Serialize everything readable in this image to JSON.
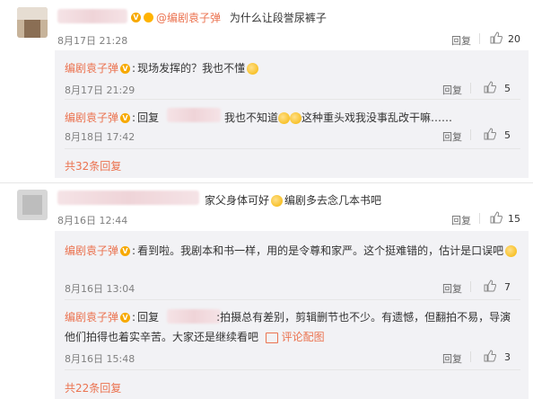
{
  "thread1": {
    "top": {
      "prefix": "",
      "mention": "@编剧袁子弹",
      "text": "为什么让段誉尿裤子",
      "time": "8月17日 21:28",
      "reply_label": "回复",
      "likes": "20"
    },
    "replies": [
      {
        "author": "编剧袁子弹",
        "text": "现场发挥的？我也不懂",
        "time": "8月17日 21:29",
        "reply_label": "回复",
        "likes": "5"
      },
      {
        "author": "编剧袁子弹",
        "reply_word": "回复",
        "text_a": "我也不知道",
        "text_b": "这种重头戏我没事乱改干嘛……",
        "time": "8月18日 17:42",
        "reply_label": "回复",
        "likes": "5"
      }
    ],
    "more": "共32条回复"
  },
  "thread2": {
    "top": {
      "text": "家父身体可好",
      "text_b": "编剧多去念几本书吧",
      "time": "8月16日 12:44",
      "reply_label": "回复",
      "likes": "15"
    },
    "replies": [
      {
        "author": "编剧袁子弹",
        "text": "看到啦。我剧本和书一样，用的是令尊和家严。这个挺难错的，估计是口误吧",
        "time": "8月16日 13:04",
        "reply_label": "回复",
        "likes": "7"
      },
      {
        "author": "编剧袁子弹",
        "reply_word": "回复",
        "text": ":拍摄总有差别，剪辑删节也不少。有遗憾，但翻拍不易，导演他们拍得也着实辛苦。大家还是继续看吧",
        "image_link": "评论配图",
        "time": "8月16日 15:48",
        "reply_label": "回复",
        "likes": "3"
      }
    ],
    "more": "共22条回复"
  },
  "colors": {
    "link": "#eb7350",
    "sub_bg": "#f2f2f5",
    "badge": "#f7a900"
  }
}
